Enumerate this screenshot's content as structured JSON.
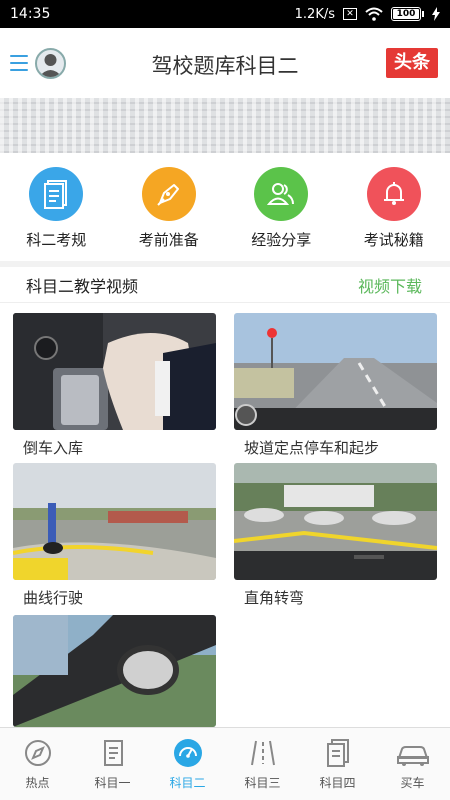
{
  "status": {
    "time": "14:35",
    "speed": "1.2K/s",
    "battery": "100"
  },
  "header": {
    "title": "驾校题库科目二",
    "badge": "头条"
  },
  "categories": [
    {
      "label": "科二考规",
      "icon": "document-icon",
      "color": "#3aa6e8"
    },
    {
      "label": "考前准备",
      "icon": "pen-icon",
      "color": "#f5a623"
    },
    {
      "label": "经验分享",
      "icon": "users-icon",
      "color": "#5bc34a"
    },
    {
      "label": "考试秘籍",
      "icon": "bell-icon",
      "color": "#f0525a"
    }
  ],
  "section": {
    "title": "科目二教学视频",
    "link": "视频下载"
  },
  "videos": [
    {
      "label": "倒车入库"
    },
    {
      "label": "坡道定点停车和起步"
    },
    {
      "label": "曲线行驶"
    },
    {
      "label": "直角转弯"
    },
    {
      "label": ""
    }
  ],
  "tabs": [
    {
      "label": "热点",
      "icon": "compass-icon"
    },
    {
      "label": "科目一",
      "icon": "book-icon"
    },
    {
      "label": "科目二",
      "icon": "gauge-icon",
      "active": true
    },
    {
      "label": "科目三",
      "icon": "road-icon"
    },
    {
      "label": "科目四",
      "icon": "pages-icon"
    },
    {
      "label": "买车",
      "icon": "car-icon"
    }
  ]
}
